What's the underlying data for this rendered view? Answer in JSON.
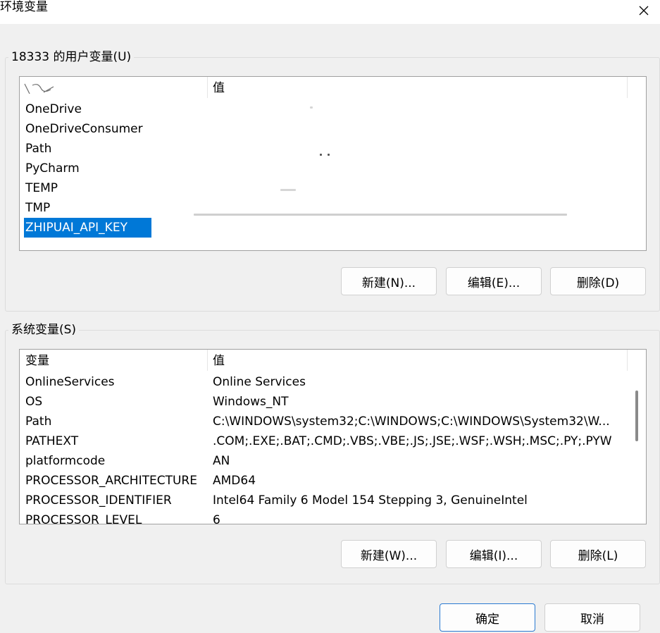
{
  "window": {
    "title": "环境变量",
    "close_glyph": "✕"
  },
  "user_vars": {
    "group_label": "18333 的用户变量(U)",
    "col_name": "变量",
    "col_value": "值",
    "rows": [
      {
        "name": "OneDrive",
        "value": ""
      },
      {
        "name": "OneDriveConsumer",
        "value": ""
      },
      {
        "name": "Path",
        "value": ""
      },
      {
        "name": "PyCharm",
        "value": ""
      },
      {
        "name": "TEMP",
        "value": ""
      },
      {
        "name": "TMP",
        "value": ""
      },
      {
        "name": "ZHIPUAI_API_KEY",
        "value": ""
      }
    ],
    "new_button": "新建(N)...",
    "edit_button": "编辑(E)...",
    "delete_button": "删除(D)"
  },
  "system_vars": {
    "group_label": "系统变量(S)",
    "col_name": "变量",
    "col_value": "值",
    "rows": [
      {
        "name": "OnlineServices",
        "value": "Online Services"
      },
      {
        "name": "OS",
        "value": "Windows_NT"
      },
      {
        "name": "Path",
        "value": "C:\\WINDOWS\\system32;C:\\WINDOWS;C:\\WINDOWS\\System32\\W..."
      },
      {
        "name": "PATHEXT",
        "value": ".COM;.EXE;.BAT;.CMD;.VBS;.VBE;.JS;.JSE;.WSF;.WSH;.MSC;.PY;.PYW"
      },
      {
        "name": "platformcode",
        "value": "AN"
      },
      {
        "name": "PROCESSOR_ARCHITECTURE",
        "value": "AMD64"
      },
      {
        "name": "PROCESSOR_IDENTIFIER",
        "value": "Intel64 Family 6 Model 154 Stepping 3, GenuineIntel"
      },
      {
        "name": "PROCESSOR_LEVEL",
        "value": "6"
      }
    ],
    "new_button": "新建(W)...",
    "edit_button": "编辑(I)...",
    "delete_button": "删除(L)"
  },
  "footer": {
    "ok_button": "确定",
    "cancel_button": "取消"
  },
  "colors": {
    "selection": "#0078d7",
    "default_button_border": "#2a7ad2",
    "dialog_bg": "#f0f0f0"
  },
  "selected_user_row": "ZHIPUAI_API_KEY"
}
